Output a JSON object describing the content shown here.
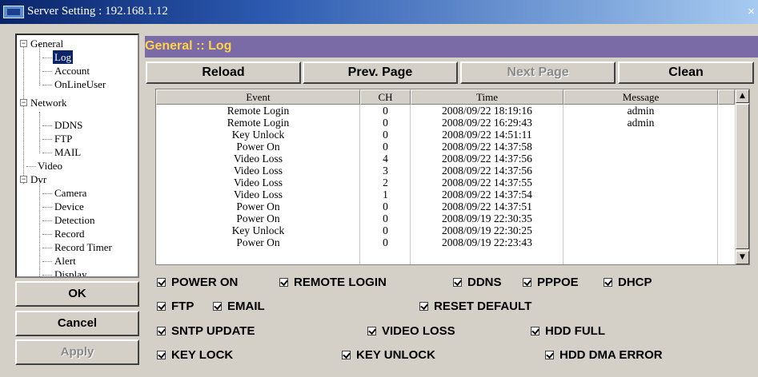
{
  "window": {
    "title": "Server Setting : 192.168.1.12",
    "close_glyph": "×"
  },
  "tree": [
    {
      "label": "General",
      "expander": "−",
      "selected": false
    },
    {
      "label": "Log",
      "selected": true
    },
    {
      "label": "Account",
      "selected": false
    },
    {
      "label": "OnLineUser",
      "selected": false
    },
    {
      "label": "Network",
      "expander": "−",
      "selected": false
    },
    {
      "label": "DDNS",
      "selected": false
    },
    {
      "label": "FTP",
      "selected": false
    },
    {
      "label": "MAIL",
      "selected": false
    },
    {
      "label": "Video",
      "selected": false
    },
    {
      "label": "Dvr",
      "expander": "−",
      "selected": false
    },
    {
      "label": "Camera",
      "selected": false
    },
    {
      "label": "Device",
      "selected": false
    },
    {
      "label": "Detection",
      "selected": false
    },
    {
      "label": "Record",
      "selected": false
    },
    {
      "label": "Record Timer",
      "selected": false
    },
    {
      "label": "Alert",
      "selected": false
    },
    {
      "label": "Display",
      "selected": false
    }
  ],
  "left_buttons": {
    "ok": "OK",
    "cancel": "Cancel",
    "apply": "Apply"
  },
  "header": {
    "title": "General :: Log"
  },
  "toolbar": {
    "reload": "Reload",
    "prev": "Prev. Page",
    "next": "Next Page",
    "clean": "Clean"
  },
  "table": {
    "columns": [
      "Event",
      "CH",
      "Time",
      "Message"
    ],
    "rows": [
      [
        "Remote Login",
        "0",
        "2008/09/22 18:19:16",
        "admin"
      ],
      [
        "Remote Login",
        "0",
        "2008/09/22 16:29:43",
        "admin"
      ],
      [
        "Key Unlock",
        "0",
        "2008/09/22 14:51:11",
        ""
      ],
      [
        "Power On",
        "0",
        "2008/09/22 14:37:58",
        ""
      ],
      [
        "Video Loss",
        "4",
        "2008/09/22 14:37:56",
        ""
      ],
      [
        "Video Loss",
        "3",
        "2008/09/22 14:37:56",
        ""
      ],
      [
        "Video Loss",
        "2",
        "2008/09/22 14:37:55",
        ""
      ],
      [
        "Video Loss",
        "1",
        "2008/09/22 14:37:54",
        ""
      ],
      [
        "Power On",
        "0",
        "2008/09/22 14:37:51",
        ""
      ],
      [
        "Power On",
        "0",
        "2008/09/19 22:30:35",
        ""
      ],
      [
        "Key Unlock",
        "0",
        "2008/09/19 22:30:25",
        ""
      ],
      [
        "Power On",
        "0",
        "2008/09/19 22:23:43",
        ""
      ]
    ],
    "scroll_up_glyph": "▲",
    "scroll_down_glyph": "▼"
  },
  "filters": {
    "power_on": "POWER ON",
    "remote_login": "REMOTE LOGIN",
    "ddns": "DDNS",
    "pppoe": "PPPOE",
    "dhcp": "DHCP",
    "ftp": "FTP",
    "email": "EMAIL",
    "reset_default": "RESET DEFAULT",
    "sntp_update": "SNTP UPDATE",
    "video_loss": "VIDEO LOSS",
    "hdd_full": "HDD FULL",
    "key_lock": "KEY LOCK",
    "key_unlock": "KEY UNLOCK",
    "hdd_dma_error": "HDD DMA ERROR"
  },
  "colors": {
    "title_bar": "#0a246a",
    "header_bg": "#7a6aa6",
    "header_text": "#ffd24a",
    "selection": "#0a246a",
    "face": "#d4d0c8"
  }
}
